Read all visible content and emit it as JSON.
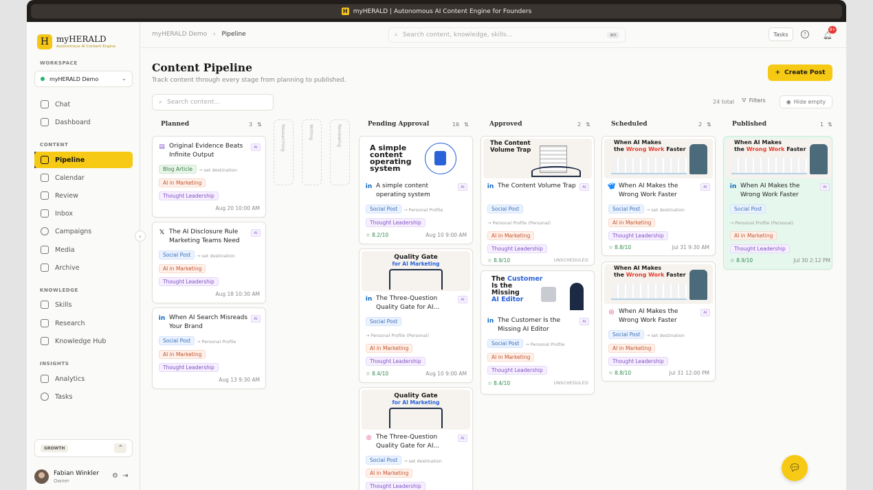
{
  "window_title": "myHERALD | Autonomous AI Content Engine for Founders",
  "app_icon_letter": "H",
  "brand": {
    "name": "myHERALD",
    "tagline": "Autonomous AI Content Engine",
    "logo_letter": "H"
  },
  "sidebar": {
    "workspace_label": "WORKSPACE",
    "workspace_name": "myHERALD Demo",
    "sections": [
      {
        "label": "CONTENT",
        "items": [
          {
            "label": "Chat"
          },
          {
            "label": "Dashboard"
          }
        ]
      },
      {
        "label": "CONTENT"
      }
    ],
    "top_items": [
      {
        "label": "Chat"
      },
      {
        "label": "Dashboard"
      }
    ],
    "content_label": "CONTENT",
    "content_items": [
      {
        "label": "Pipeline"
      },
      {
        "label": "Calendar"
      },
      {
        "label": "Review"
      },
      {
        "label": "Inbox"
      },
      {
        "label": "Campaigns"
      },
      {
        "label": "Media"
      },
      {
        "label": "Archive"
      }
    ],
    "knowledge_label": "KNOWLEDGE",
    "knowledge_items": [
      {
        "label": "Skills"
      },
      {
        "label": "Research"
      },
      {
        "label": "Knowledge Hub"
      }
    ],
    "insights_label": "INSIGHTS",
    "insights_items": [
      {
        "label": "Analytics"
      },
      {
        "label": "Tasks"
      }
    ],
    "plan": "GROWTH",
    "user": {
      "name": "Fabian Winkler",
      "role": "Owner"
    }
  },
  "topbar": {
    "breadcrumb_root": "myHERALD Demo",
    "breadcrumb_current": "Pipeline",
    "search_placeholder": "Search content, knowledge, skills...",
    "search_shortcut": "⌘K",
    "tasks_label": "Tasks",
    "notif_count": "9+"
  },
  "page": {
    "title": "Content Pipeline",
    "subtitle": "Track content through every stage from planning to published.",
    "create_label": "Create Post",
    "search_placeholder": "Search content...",
    "total": "24 total",
    "filters_label": "Filters",
    "hide_empty_label": "Hide empty"
  },
  "columns": [
    {
      "name": "Planned",
      "count": "3"
    },
    {
      "name": "Researching"
    },
    {
      "name": "Writing"
    },
    {
      "name": "Reviewing"
    },
    {
      "name": "Pending Approval",
      "count": "16"
    },
    {
      "name": "Approved",
      "count": "2"
    },
    {
      "name": "Scheduled",
      "count": "2"
    },
    {
      "name": "Published",
      "count": "1"
    }
  ],
  "tags": {
    "blog": "Blog Article",
    "social": "Social Post",
    "ai_marketing": "AI in Marketing",
    "thought": "Thought Leadership",
    "ai": "AI",
    "unscheduled": "UNSCHEDULED",
    "set_dest": "→ set destination",
    "personal": "→ Personal Profile",
    "personal_personal": "→ Personal Profile (Personal)"
  },
  "cards": {
    "p1": {
      "title": "Original Evidence Beats Infinite Output",
      "date": "Aug 20 10:00 AM"
    },
    "p2": {
      "title": "The AI Disclosure Rule Marketing Teams Need",
      "date": "Aug 18 10:30 AM"
    },
    "p3": {
      "title": "When AI Search Misreads Your Brand",
      "date": "Aug 13 9:30 AM"
    },
    "pa1": {
      "title": "A simple content operating system",
      "score": "8.2/10",
      "date": "Aug 10 9:00 AM",
      "thumb": "A simple content operating system"
    },
    "pa2": {
      "title": "The Three-Question Quality Gate for AI...",
      "score": "8.4/10",
      "date": "Aug 10 9:00 AM",
      "thumb_line1": "Quality Gate",
      "thumb_line2": "for AI Marketing"
    },
    "pa3": {
      "title": "The Three-Question Quality Gate for AI...",
      "thumb_line1": "Quality Gate",
      "thumb_line2": "for AI Marketing"
    },
    "a1": {
      "title": "The Content Volume Trap",
      "score": "8.9/10",
      "thumb": "The Content Volume Trap"
    },
    "a2": {
      "title": "The Customer Is the Missing AI Editor",
      "score": "8.4/10",
      "thumb_l1": "The",
      "thumb_l2": "Customer",
      "thumb_l3": "Is the",
      "thumb_l4": "Missing",
      "thumb_l5": "AI Editor"
    },
    "s1": {
      "title": "When AI Makes the Wrong Work Faster",
      "score": "8.8/10",
      "date": "Jul 31 9:30 AM",
      "thumb_a": "When AI Makes",
      "thumb_b": "the",
      "thumb_c": "Wrong Work",
      "thumb_d": "Faster"
    },
    "s2": {
      "title": "When AI Makes the Wrong Work Faster",
      "score": "8.8/10",
      "date": "Jul 31 12:00 PM",
      "thumb_a": "When AI Makes",
      "thumb_b": "the",
      "thumb_c": "Wrong Work",
      "thumb_d": "Faster"
    },
    "pb1": {
      "title": "When AI Makes the Wrong Work Faster",
      "score": "8.9/10",
      "date": "Jul 30 2:12 PM",
      "thumb_a": "When AI Makes",
      "thumb_b": "the",
      "thumb_c": "Wrong Work",
      "thumb_d": "Faster"
    }
  },
  "colors": {
    "accent": "#f6c915",
    "linkedin": "#0a66c2",
    "x": "#1d9bf0",
    "bluesky": "#1185fe",
    "instagram": "#d62976",
    "score": "#2f8a4c"
  }
}
